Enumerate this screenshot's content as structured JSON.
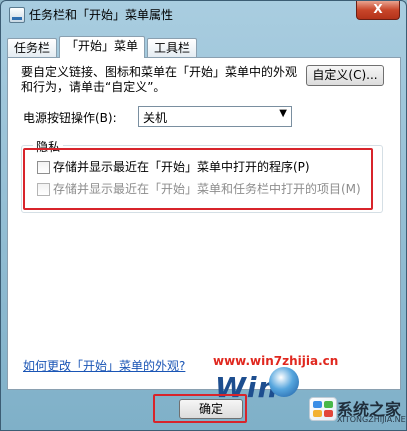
{
  "window": {
    "title": "任务栏和「开始」菜单属性",
    "close_label": "X"
  },
  "tabs": [
    {
      "label": "任务栏"
    },
    {
      "label": "「开始」菜单"
    },
    {
      "label": "工具栏"
    }
  ],
  "start_menu": {
    "description": "要自定义链接、图标和菜单在「开始」菜单中的外观和行为，请单击“自定义”。",
    "customize_button": "自定义(C)...",
    "power_label": "电源按钮操作(B):",
    "power_value": "关机",
    "privacy_label": "隐私",
    "checkboxes": [
      {
        "label": "存储并显示最近在「开始」菜单中打开的程序(P)",
        "checked": false,
        "disabled": false
      },
      {
        "label": "存储并显示最近在「开始」菜单和任务栏中打开的项目(M)",
        "checked": false,
        "disabled": true
      }
    ],
    "help_link": "如何更改「开始」菜单的外观?"
  },
  "footer": {
    "ok_button": "确定"
  },
  "watermark": {
    "url": "www.win7zhijia.cn",
    "logo_text": "Win",
    "brand_name": "系统之家",
    "brand_sub": "XITONGZHIJIA.NET"
  },
  "colors": {
    "highlight": "#d8242b",
    "link": "#1a55b5",
    "watermark_url": "#e0281f"
  }
}
